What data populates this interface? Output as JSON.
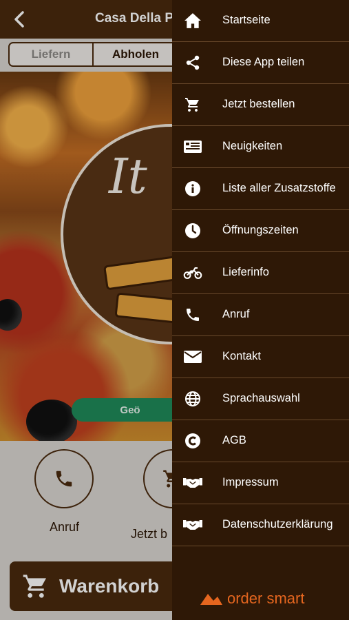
{
  "header": {
    "title": "Casa Della Pi",
    "back_icon": "chevron-left-icon"
  },
  "delivery_toggle": {
    "options": [
      "Liefern",
      "Abholen"
    ],
    "selected": "Abholen"
  },
  "status_pill": {
    "text": "Geö"
  },
  "actions": [
    {
      "label": "Anruf",
      "icon": "phone-icon"
    },
    {
      "label": "Jetzt b",
      "icon": "cart-icon"
    }
  ],
  "cart_button": {
    "label": "Warenkorb",
    "icon": "cart-icon"
  },
  "drawer": {
    "items": [
      {
        "label": "Startseite",
        "icon": "home-icon"
      },
      {
        "label": "Diese App teilen",
        "icon": "share-icon"
      },
      {
        "label": "Jetzt bestellen",
        "icon": "cart-icon"
      },
      {
        "label": "Neuigkeiten",
        "icon": "news-icon"
      },
      {
        "label": "Liste aller Zusatzstoffe",
        "icon": "info-icon"
      },
      {
        "label": "Öffnungszeiten",
        "icon": "clock-icon"
      },
      {
        "label": "Lieferinfo",
        "icon": "motorbike-icon"
      },
      {
        "label": "Anruf",
        "icon": "phone-icon"
      },
      {
        "label": "Kontakt",
        "icon": "mail-icon"
      },
      {
        "label": "Sprachauswahl",
        "icon": "globe-icon"
      },
      {
        "label": "AGB",
        "icon": "copyright-icon"
      },
      {
        "label": "Impressum",
        "icon": "handshake-icon"
      },
      {
        "label": "Datenschutzerklärung",
        "icon": "handshake-icon"
      }
    ],
    "brand": "order smart"
  },
  "colors": {
    "header": "#4a2a0e",
    "drawer": "#2e1806",
    "divider": "#6a4a2c",
    "brand_orange": "#e5661f",
    "status_green": "#1f8a5a"
  }
}
